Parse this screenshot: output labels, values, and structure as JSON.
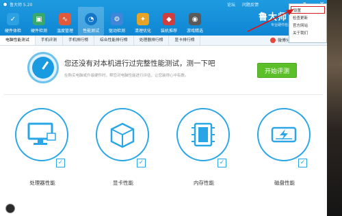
{
  "window": {
    "title": "鲁大师 5.20"
  },
  "top_links": [
    "论坛",
    "问题反馈"
  ],
  "window_buttons": [
    "▾",
    "—",
    "✕"
  ],
  "toolbar": [
    {
      "label": "硬件体检",
      "icon": "hardware-check-icon",
      "color": "#2ea1e3"
    },
    {
      "label": "硬件检测",
      "icon": "hardware-detect-icon",
      "color": "#38a96b"
    },
    {
      "label": "温度管理",
      "icon": "temperature-icon",
      "color": "#e25a3c"
    },
    {
      "label": "性能测试",
      "icon": "performance-test-icon",
      "color": "#1177c6"
    },
    {
      "label": "驱动检测",
      "icon": "driver-detect-icon",
      "color": "#3f86d8"
    },
    {
      "label": "清理优化",
      "icon": "cleanup-icon",
      "color": "#e7a228"
    },
    {
      "label": "装机推荐",
      "icon": "install-recommend-icon",
      "color": "#cf3e3e"
    },
    {
      "label": "游戏精选",
      "icon": "game-icon",
      "color": "#5a5a5a"
    }
  ],
  "brand": {
    "name": "鲁大师",
    "tagline": "专业硬件检测"
  },
  "menu": {
    "items": [
      "设置",
      "检查更新",
      "官方网站",
      "关于我们"
    ]
  },
  "tabs": [
    "电脑性能测试",
    "手机评测",
    "手机排行榜",
    "综合性能排行榜",
    "处理器排行榜",
    "显卡排行榜"
  ],
  "share_label": "微博分享",
  "prompt": {
    "title": "您还没有对本机进行过完整性能测试，测一下吧",
    "subtitle": "在购买电脑或升级硬件时，帮您对电脑性能进行评估，让您装得心中有数。"
  },
  "start_button": "开始评测",
  "cards": [
    {
      "label": "处理器性能",
      "icon": "cpu-monitor-icon"
    },
    {
      "label": "显卡性能",
      "icon": "gpu-cube-icon"
    },
    {
      "label": "内存性能",
      "icon": "memory-chip-icon"
    },
    {
      "label": "磁盘性能",
      "icon": "disk-bolt-icon"
    }
  ],
  "accent": "#2aa6e6"
}
